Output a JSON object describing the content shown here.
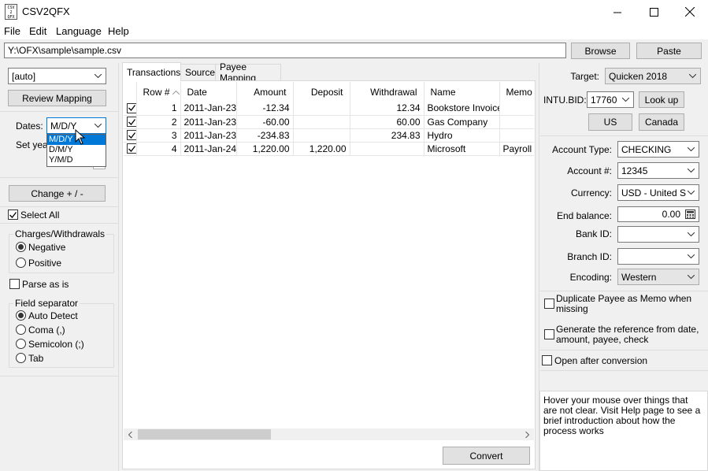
{
  "window": {
    "title": "CSV2QFX",
    "icon_text": [
      "CSV",
      "2",
      "QFX"
    ],
    "controls": [
      "minimize-icon",
      "maximize-icon",
      "close-icon"
    ]
  },
  "menu": [
    "File",
    "Edit",
    "Language",
    "Help"
  ],
  "file": {
    "path": "Y:\\OFX\\sample\\sample.csv",
    "browse_label": "Browse",
    "paste_label": "Paste"
  },
  "left": {
    "mapping_preset": "[auto]",
    "review_mapping_label": "Review Mapping",
    "dates_label": "Dates:",
    "dates_value": "M/D/Y",
    "dates_options": [
      "M/D/Y",
      "D/M/Y",
      "Y/M/D"
    ],
    "set_year_label": "Set yea",
    "change_sign_label": "Change + / -",
    "select_all_label": "Select All",
    "charges_group_title": "Charges/Withdrawals",
    "charges_options": [
      "Negative",
      "Positive"
    ],
    "parse_as_is_label": "Parse as is",
    "separator_group_title": "Field separator",
    "separator_options": [
      "Auto Detect",
      "Coma (,)",
      "Semicolon (;)",
      "Tab"
    ]
  },
  "tabs": [
    "Transactions",
    "Source",
    "Payee Mapping"
  ],
  "table": {
    "columns": [
      "Row #",
      "Date",
      "Amount",
      "Deposit",
      "Withdrawal",
      "Name",
      "Memo"
    ],
    "rows": [
      {
        "row": "1",
        "date": "2011-Jan-23",
        "amount": "-12.34",
        "deposit": "",
        "withdrawal": "12.34",
        "name": "Bookstore Invoice",
        "memo": ""
      },
      {
        "row": "2",
        "date": "2011-Jan-23",
        "amount": "-60.00",
        "deposit": "",
        "withdrawal": "60.00",
        "name": "Gas Company",
        "memo": ""
      },
      {
        "row": "3",
        "date": "2011-Jan-23",
        "amount": "-234.83",
        "deposit": "",
        "withdrawal": "234.83",
        "name": "Hydro",
        "memo": ""
      },
      {
        "row": "4",
        "date": "2011-Jan-24",
        "amount": "1,220.00",
        "deposit": "1,220.00",
        "withdrawal": "",
        "name": "Microsoft",
        "memo": "Payroll"
      }
    ]
  },
  "convert_label": "Convert",
  "right": {
    "target_label": "Target:",
    "target_value": "Quicken 2018",
    "intu_bid_label": "INTU.BID:",
    "intu_bid_value": "17760",
    "lookup_label": "Look up",
    "us_label": "US",
    "canada_label": "Canada",
    "account_type_label": "Account Type:",
    "account_type_value": "CHECKING",
    "account_num_label": "Account #:",
    "account_num_value": "12345",
    "currency_label": "Currency:",
    "currency_value": "USD - United Sta",
    "end_balance_label": "End balance:",
    "end_balance_value": "0.00",
    "bank_id_label": "Bank ID:",
    "branch_id_label": "Branch ID:",
    "encoding_label": "Encoding:",
    "encoding_value": "Western",
    "dup_payee_label": "Duplicate Payee as Memo when missing",
    "gen_ref_label": "Generate the reference from date, amount, payee, check",
    "open_after_label": "Open after conversion",
    "help_text": "Hover your mouse over things that are not clear. Visit Help page to see a brief introduction about how the process works"
  },
  "colors": {
    "selection": "#0078d7",
    "focus_border": "#0078d7",
    "window_bg": "#f0f0f0"
  }
}
